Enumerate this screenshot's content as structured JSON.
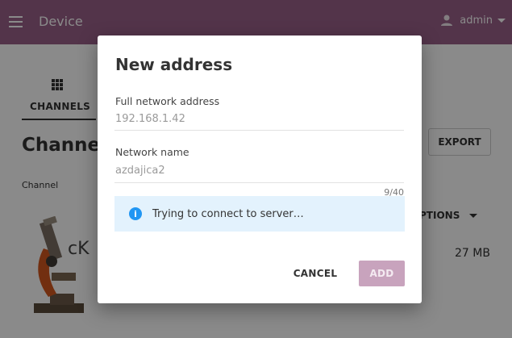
{
  "appbar": {
    "title": "Device",
    "user_name": "admin"
  },
  "page": {
    "tab_label": "CHANNELS",
    "heading": "Channe",
    "export_label": "EXPORT",
    "channel_caption": "Channel",
    "options_label": "PTIONS",
    "size": "27 MB",
    "logo_text": "cK"
  },
  "dialog": {
    "title": "New address",
    "address_label": "Full network address",
    "address_value": "192.168.1.42",
    "name_label": "Network name",
    "name_value": "azdajica2",
    "name_counter": "9/40",
    "status_message": "Trying to connect to server…",
    "cancel_label": "CANCEL",
    "add_label": "ADD"
  },
  "colors": {
    "appbar": "#996189",
    "info": "#2196f3",
    "banner_bg": "#e3f2fd",
    "add_disabled": "#c8a3bd"
  },
  "icons": {
    "menu": "hamburger-menu-icon",
    "user": "person-icon",
    "caret": "caret-down-icon",
    "tab": "grid-icon",
    "info": "info-icon"
  }
}
